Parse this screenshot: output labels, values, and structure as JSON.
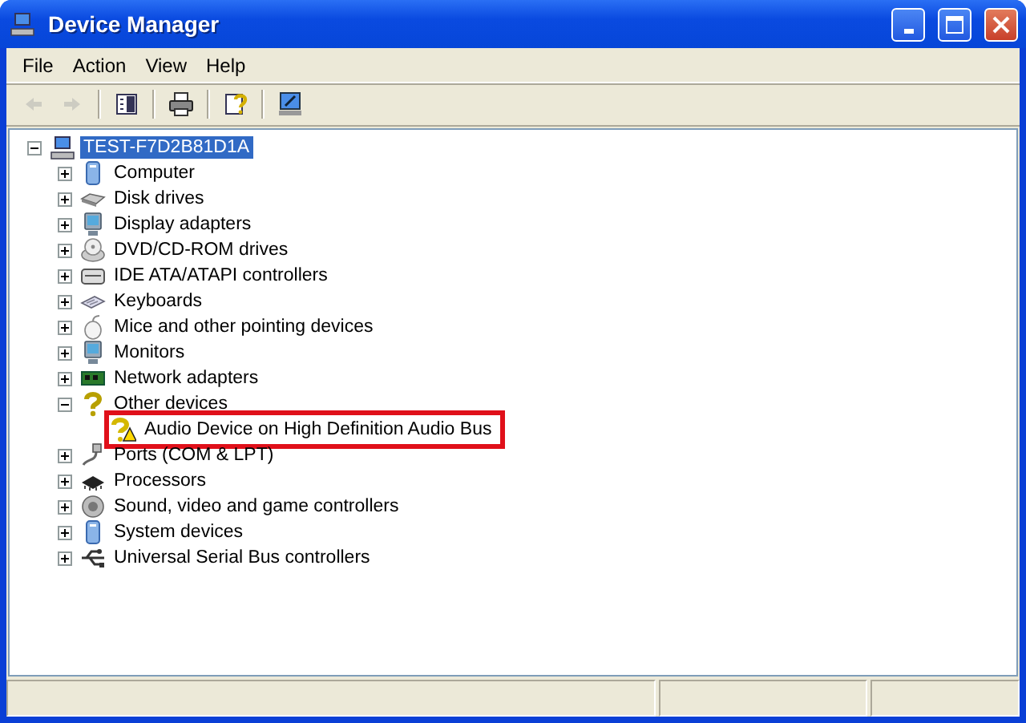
{
  "window": {
    "title": "Device Manager"
  },
  "menu": [
    {
      "label": "File"
    },
    {
      "label": "Action"
    },
    {
      "label": "View"
    },
    {
      "label": "Help"
    }
  ],
  "toolbar": [
    {
      "kind": "back",
      "disabled": true
    },
    {
      "kind": "forward",
      "disabled": true
    },
    {
      "kind": "separator"
    },
    {
      "kind": "tree",
      "disabled": false
    },
    {
      "kind": "separator"
    },
    {
      "kind": "print",
      "disabled": false
    },
    {
      "kind": "separator"
    },
    {
      "kind": "help",
      "disabled": false
    },
    {
      "kind": "separator"
    },
    {
      "kind": "update",
      "disabled": false
    }
  ],
  "tree": {
    "label": "TEST-F7D2B81D1A",
    "expanded": true,
    "selected": true,
    "children": [
      {
        "label": "Computer",
        "kind": "computer",
        "expanded": false,
        "selected": false
      },
      {
        "label": "Disk drives",
        "kind": "disk",
        "expanded": false,
        "selected": false
      },
      {
        "label": "Display adapters",
        "kind": "monitor",
        "expanded": false,
        "selected": false
      },
      {
        "label": "DVD/CD-ROM drives",
        "kind": "disc",
        "expanded": false,
        "selected": false
      },
      {
        "label": "IDE ATA/ATAPI controllers",
        "kind": "drive",
        "expanded": false,
        "selected": false
      },
      {
        "label": "Keyboards",
        "kind": "keyboard",
        "expanded": false,
        "selected": false
      },
      {
        "label": "Mice and other pointing devices",
        "kind": "mouse",
        "expanded": false,
        "selected": false
      },
      {
        "label": "Monitors",
        "kind": "monitor",
        "expanded": false,
        "selected": false
      },
      {
        "label": "Network adapters",
        "kind": "board",
        "expanded": false,
        "selected": false
      },
      {
        "label": "Other devices",
        "kind": "question",
        "expanded": true,
        "selected": false,
        "children": [
          {
            "label": "Audio Device on High Definition Audio Bus",
            "kind": "warning",
            "selected": false,
            "highlighted": true
          }
        ]
      },
      {
        "label": "Ports (COM & LPT)",
        "kind": "plug",
        "expanded": false,
        "selected": false
      },
      {
        "label": "Processors",
        "kind": "chip",
        "expanded": false,
        "selected": false
      },
      {
        "label": "Sound, video and game controllers",
        "kind": "speaker",
        "expanded": false,
        "selected": false
      },
      {
        "label": "System devices",
        "kind": "computer",
        "expanded": false,
        "selected": false
      },
      {
        "label": "Universal Serial Bus controllers",
        "kind": "usb",
        "expanded": false,
        "selected": false
      }
    ]
  }
}
